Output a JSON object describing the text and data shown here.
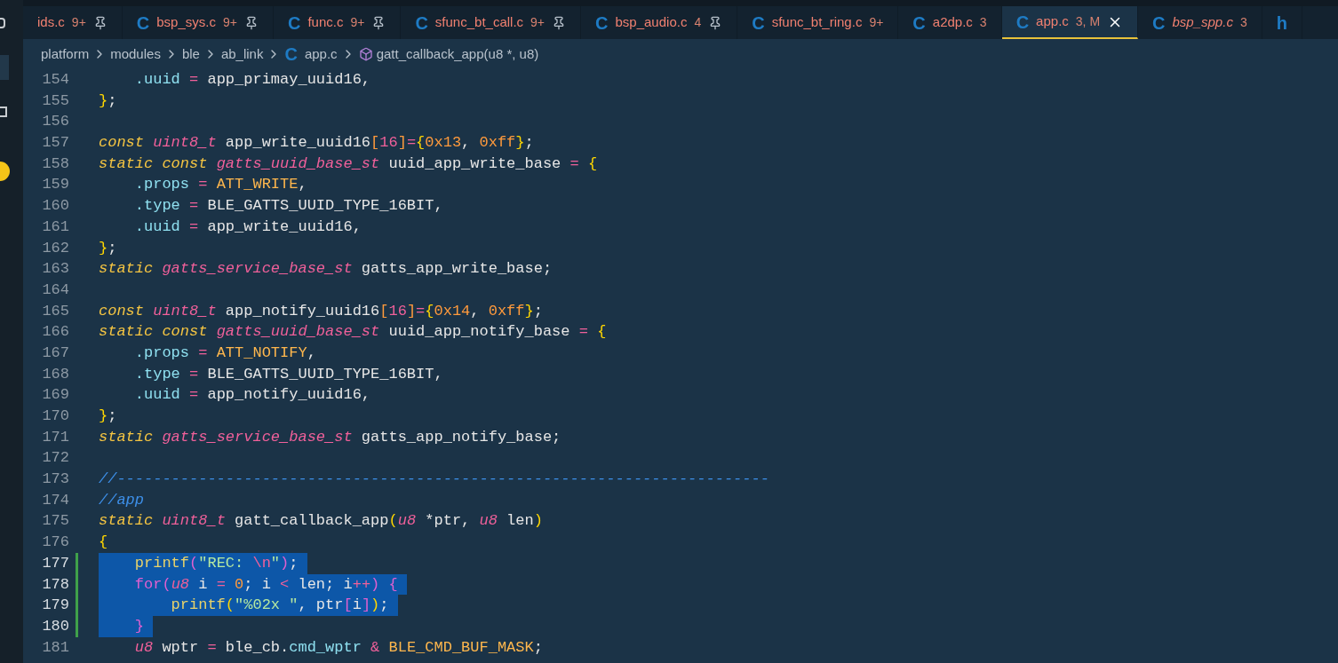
{
  "tabs": [
    {
      "name": "ids.c",
      "badge": "9+",
      "pinned": true,
      "italic": false,
      "selected": false,
      "closable": false
    },
    {
      "icon": "C",
      "name": "bsp_sys.c",
      "badge": "9+",
      "pinned": true,
      "italic": false,
      "selected": false,
      "closable": false
    },
    {
      "icon": "C",
      "name": "func.c",
      "badge": "9+",
      "pinned": true,
      "italic": false,
      "selected": false,
      "closable": false
    },
    {
      "icon": "C",
      "name": "sfunc_bt_call.c",
      "badge": "9+",
      "pinned": true,
      "italic": false,
      "selected": false,
      "closable": false
    },
    {
      "icon": "C",
      "name": "bsp_audio.c",
      "badge": "4",
      "pinned": true,
      "italic": false,
      "selected": false,
      "closable": false
    },
    {
      "icon": "C",
      "name": "sfunc_bt_ring.c",
      "badge": "9+",
      "pinned": false,
      "italic": false,
      "selected": false,
      "closable": false
    },
    {
      "icon": "C",
      "name": "a2dp.c",
      "badge": "3",
      "pinned": false,
      "italic": false,
      "selected": false,
      "closable": false
    },
    {
      "icon": "C",
      "name": "app.c",
      "badge": "3, M",
      "pinned": false,
      "italic": false,
      "selected": true,
      "closable": true
    },
    {
      "icon": "C",
      "name": "bsp_spp.c",
      "badge": "3",
      "pinned": false,
      "italic": true,
      "selected": false,
      "closable": false
    },
    {
      "icon": "h",
      "pinned": false,
      "selected": false,
      "closable": false
    }
  ],
  "breadcrumb": [
    {
      "kind": "folder",
      "label": "platform"
    },
    {
      "kind": "folder",
      "label": "modules"
    },
    {
      "kind": "folder",
      "label": "ble"
    },
    {
      "kind": "folder",
      "label": "ab_link"
    },
    {
      "kind": "file",
      "icon": "C",
      "label": "app.c"
    },
    {
      "kind": "symbol",
      "label": "gatt_callback_app(u8 *, u8)"
    }
  ],
  "lines": [
    {
      "number": "154",
      "selected": false,
      "modified": false,
      "tokens": [
        {
          "t": "    .uuid",
          "kind": "prop"
        },
        {
          "t": " =",
          "kind": "op"
        },
        {
          "t": " app_primay_uuid16,",
          "kind": "p"
        }
      ]
    },
    {
      "number": "155",
      "selected": false,
      "modified": false,
      "tokens": [
        {
          "t": "}",
          "kind": "pu"
        },
        {
          "t": ";",
          "kind": "p"
        }
      ]
    },
    {
      "number": "156",
      "selected": false,
      "modified": false
    },
    {
      "number": "157",
      "selected": false,
      "modified": false,
      "tokens": [
        {
          "t": "const",
          "kind": "kw"
        },
        {
          "t": " uint8_t",
          "kind": "type"
        },
        {
          "t": " app_write_uuid16",
          "kind": "p"
        },
        {
          "t": "[",
          "kind": "br"
        },
        {
          "t": "16",
          "kind": "num2"
        },
        {
          "t": "]",
          "kind": "br"
        },
        {
          "t": "=",
          "kind": "op"
        },
        {
          "t": "{",
          "kind": "pu"
        },
        {
          "t": "0x13",
          "kind": "num"
        },
        {
          "t": ",",
          "kind": "p"
        },
        {
          "t": " 0xff",
          "kind": "num"
        },
        {
          "t": "}",
          "kind": "pu"
        },
        {
          "t": ";",
          "kind": "p"
        }
      ]
    },
    {
      "number": "158",
      "selected": false,
      "modified": false,
      "tokens": [
        {
          "t": "static",
          "kind": "kw"
        },
        {
          "t": " const",
          "kind": "kw"
        },
        {
          "t": " gatts_uuid_base_st",
          "kind": "type"
        },
        {
          "t": " uuid_app_write_base",
          "kind": "p"
        },
        {
          "t": " =",
          "kind": "op"
        },
        {
          "t": " {",
          "kind": "pu"
        }
      ]
    },
    {
      "number": "159",
      "selected": false,
      "modified": false,
      "tokens": [
        {
          "t": "    .props",
          "kind": "prop"
        },
        {
          "t": " =",
          "kind": "op"
        },
        {
          "t": " ATT_WRITE",
          "kind": "mac"
        },
        {
          "t": ",",
          "kind": "p"
        }
      ]
    },
    {
      "number": "160",
      "selected": false,
      "modified": false,
      "tokens": [
        {
          "t": "    .type",
          "kind": "prop"
        },
        {
          "t": " =",
          "kind": "op"
        },
        {
          "t": " BLE_GATTS_UUID_TYPE_16BIT,",
          "kind": "p"
        }
      ]
    },
    {
      "number": "161",
      "selected": false,
      "modified": false,
      "tokens": [
        {
          "t": "    .uuid",
          "kind": "prop"
        },
        {
          "t": " =",
          "kind": "op"
        },
        {
          "t": " app_write_uuid16,",
          "kind": "p"
        }
      ]
    },
    {
      "number": "162",
      "selected": false,
      "modified": false,
      "tokens": [
        {
          "t": "}",
          "kind": "pu"
        },
        {
          "t": ";",
          "kind": "p"
        }
      ]
    },
    {
      "number": "163",
      "selected": false,
      "modified": false,
      "tokens": [
        {
          "t": "static",
          "kind": "kw"
        },
        {
          "t": " gatts_service_base_st",
          "kind": "type"
        },
        {
          "t": " gatts_app_write_base;",
          "kind": "p"
        }
      ]
    },
    {
      "number": "164",
      "selected": false,
      "modified": false
    },
    {
      "number": "165",
      "selected": false,
      "modified": false,
      "tokens": [
        {
          "t": "const",
          "kind": "kw"
        },
        {
          "t": " uint8_t",
          "kind": "type"
        },
        {
          "t": " app_notify_uuid16",
          "kind": "p"
        },
        {
          "t": "[",
          "kind": "br"
        },
        {
          "t": "16",
          "kind": "num2"
        },
        {
          "t": "]",
          "kind": "br"
        },
        {
          "t": "=",
          "kind": "op"
        },
        {
          "t": "{",
          "kind": "pu"
        },
        {
          "t": "0x14",
          "kind": "num"
        },
        {
          "t": ",",
          "kind": "p"
        },
        {
          "t": " 0xff",
          "kind": "num"
        },
        {
          "t": "}",
          "kind": "pu"
        },
        {
          "t": ";",
          "kind": "p"
        }
      ]
    },
    {
      "number": "166",
      "selected": false,
      "modified": false,
      "tokens": [
        {
          "t": "static",
          "kind": "kw"
        },
        {
          "t": " const",
          "kind": "kw"
        },
        {
          "t": " gatts_uuid_base_st",
          "kind": "type"
        },
        {
          "t": " uuid_app_notify_base",
          "kind": "p"
        },
        {
          "t": " =",
          "kind": "op"
        },
        {
          "t": " {",
          "kind": "pu"
        }
      ]
    },
    {
      "number": "167",
      "selected": false,
      "modified": false,
      "tokens": [
        {
          "t": "    .props",
          "kind": "prop"
        },
        {
          "t": " =",
          "kind": "op"
        },
        {
          "t": " ATT_NOTIFY",
          "kind": "mac"
        },
        {
          "t": ",",
          "kind": "p"
        }
      ]
    },
    {
      "number": "168",
      "selected": false,
      "modified": false,
      "tokens": [
        {
          "t": "    .type",
          "kind": "prop"
        },
        {
          "t": " =",
          "kind": "op"
        },
        {
          "t": " BLE_GATTS_UUID_TYPE_16BIT,",
          "kind": "p"
        }
      ]
    },
    {
      "number": "169",
      "selected": false,
      "modified": false,
      "tokens": [
        {
          "t": "    .uuid",
          "kind": "prop"
        },
        {
          "t": " =",
          "kind": "op"
        },
        {
          "t": " app_notify_uuid16,",
          "kind": "p"
        }
      ]
    },
    {
      "number": "170",
      "selected": false,
      "modified": false,
      "tokens": [
        {
          "t": "}",
          "kind": "pu"
        },
        {
          "t": ";",
          "kind": "p"
        }
      ]
    },
    {
      "number": "171",
      "selected": false,
      "modified": false,
      "tokens": [
        {
          "t": "static",
          "kind": "kw"
        },
        {
          "t": " gatts_service_base_st",
          "kind": "type"
        },
        {
          "t": " gatts_app_notify_base;",
          "kind": "p"
        }
      ]
    },
    {
      "number": "172",
      "selected": false,
      "modified": false
    },
    {
      "number": "173",
      "selected": false,
      "modified": false,
      "tokens": [
        {
          "t": "//------------------------------------------------------------------------",
          "kind": "cm"
        }
      ]
    },
    {
      "number": "174",
      "selected": false,
      "modified": false,
      "tokens": [
        {
          "t": "//app",
          "kind": "cm"
        }
      ]
    },
    {
      "number": "175",
      "selected": false,
      "modified": false,
      "tokens": [
        {
          "t": "static",
          "kind": "kw"
        },
        {
          "t": " uint8_t",
          "kind": "type"
        },
        {
          "t": " gatt_callback_app",
          "kind": "p"
        },
        {
          "t": "(",
          "kind": "pu"
        },
        {
          "t": "u8",
          "kind": "type"
        },
        {
          "t": " *ptr,",
          "kind": "p"
        },
        {
          "t": " u8",
          "kind": "type"
        },
        {
          "t": " len",
          "kind": "p"
        },
        {
          "t": ")",
          "kind": "pu"
        }
      ]
    },
    {
      "number": "176",
      "selected": false,
      "modified": false,
      "tokens": [
        {
          "t": "{",
          "kind": "pu"
        }
      ]
    },
    {
      "number": "177",
      "selected": true,
      "modified": true,
      "tokens": [
        {
          "t": "    printf",
          "kind": "fn"
        },
        {
          "t": "(",
          "kind": "pp"
        },
        {
          "t": "\"REC:",
          "kind": "str"
        },
        {
          "t": " \\n",
          "kind": "esc"
        },
        {
          "t": "\"",
          "kind": "str"
        },
        {
          "t": ")",
          "kind": "pp"
        },
        {
          "t": ";",
          "kind": "p"
        }
      ]
    },
    {
      "number": "178",
      "selected": true,
      "modified": true,
      "tokens": [
        {
          "t": "    for",
          "kind": "ctl"
        },
        {
          "t": "(",
          "kind": "pp"
        },
        {
          "t": "u8",
          "kind": "type"
        },
        {
          "t": " i",
          "kind": "p"
        },
        {
          "t": " =",
          "kind": "op"
        },
        {
          "t": " 0",
          "kind": "num"
        },
        {
          "t": "; i",
          "kind": "p"
        },
        {
          "t": " <",
          "kind": "op"
        },
        {
          "t": " len; i",
          "kind": "p"
        },
        {
          "t": "++",
          "kind": "op"
        },
        {
          "t": ")",
          "kind": "pp"
        },
        {
          "t": " {",
          "kind": "ctl"
        }
      ]
    },
    {
      "number": "179",
      "selected": true,
      "modified": true,
      "tokens": [
        {
          "t": "        printf",
          "kind": "fn"
        },
        {
          "t": "(",
          "kind": "pu"
        },
        {
          "t": "\"%02x \"",
          "kind": "str"
        },
        {
          "t": ", ptr",
          "kind": "p"
        },
        {
          "t": "[",
          "kind": "pp"
        },
        {
          "t": "i",
          "kind": "p"
        },
        {
          "t": "]",
          "kind": "pp"
        },
        {
          "t": ")",
          "kind": "pu"
        },
        {
          "t": ";",
          "kind": "p"
        }
      ]
    },
    {
      "number": "180",
      "selected": true,
      "modified": true,
      "tokens": [
        {
          "t": "    }",
          "kind": "ctl"
        }
      ]
    },
    {
      "number": "181",
      "selected": false,
      "modified": false,
      "tokens": [
        {
          "t": "    u8",
          "kind": "type"
        },
        {
          "t": " wptr",
          "kind": "p"
        },
        {
          "t": " =",
          "kind": "op"
        },
        {
          "t": " ble_cb.",
          "kind": "p"
        },
        {
          "t": "cmd_wptr",
          "kind": "prop"
        },
        {
          "t": " &",
          "kind": "op"
        },
        {
          "t": " BLE_CMD_BUF_MASK",
          "kind": "mac"
        },
        {
          "t": ";",
          "kind": "p"
        }
      ]
    }
  ]
}
